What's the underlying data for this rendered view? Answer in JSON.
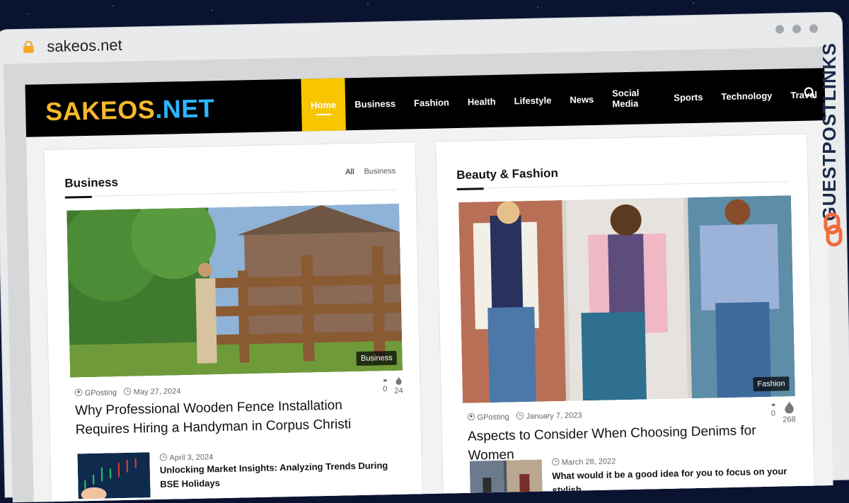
{
  "browser": {
    "url": "sakeos.net"
  },
  "site": {
    "logo": {
      "part1": "SAKEOS",
      "part2": ".NET"
    },
    "menu": [
      {
        "label": "Home",
        "active": true
      },
      {
        "label": "Business"
      },
      {
        "label": "Fashion"
      },
      {
        "label": "Health"
      },
      {
        "label": "Lifestyle"
      },
      {
        "label": "News"
      },
      {
        "label": "Social Media"
      },
      {
        "label": "Sports"
      },
      {
        "label": "Technology"
      },
      {
        "label": "Travel"
      }
    ],
    "accent": "#f7c600"
  },
  "business": {
    "title": "Business",
    "filters": [
      "All",
      "Business"
    ],
    "featured": {
      "tag": "Business",
      "author": "GPosting",
      "date": "May 27, 2024",
      "comments": "0",
      "views": "24",
      "headline": "Why Professional Wooden Fence Installation Requires Hiring a Handyman in Corpus Christi"
    },
    "secondary": {
      "date": "April 3, 2024",
      "headline": "Unlocking Market Insights: Analyzing Trends During BSE Holidays"
    }
  },
  "fashion": {
    "title": "Beauty & Fashion",
    "featured": {
      "tag": "Fashion",
      "author": "GPosting",
      "date": "January 7, 2023",
      "comments": "0",
      "views": "268",
      "headline": "Aspects to Consider When Choosing Denims for Women"
    },
    "secondary": {
      "date": "March 28, 2022",
      "headline": "What would it be a good idea for you to focus on your stylish"
    }
  },
  "watermark": {
    "text": "GUESTPOSTLINKS"
  }
}
